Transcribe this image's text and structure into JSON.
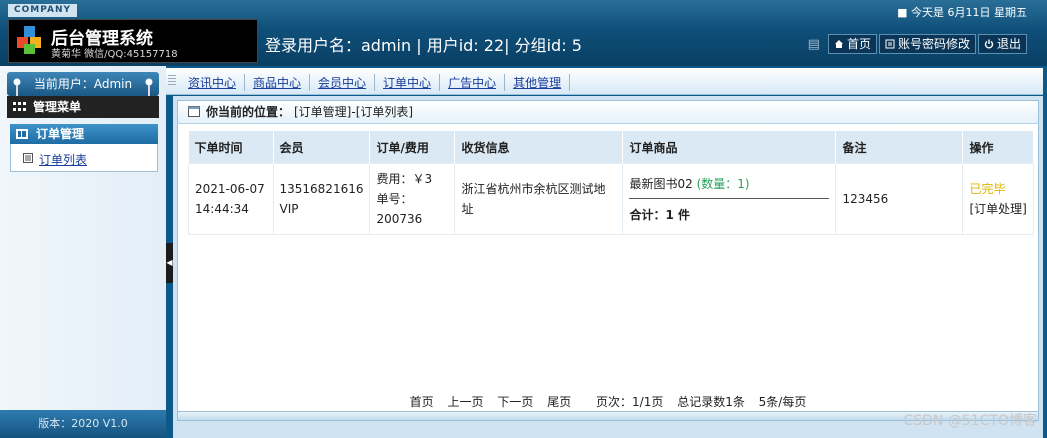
{
  "header": {
    "company_tag": "COMPANY",
    "title": "后台管理系统",
    "subtitle": "黄菊华 微信/QQ:45157718",
    "date_text": "■ 今天是 6月11日 星期五",
    "login_info": "登录用户名：admin | 用户id: 22| 分组id: 5",
    "buttons": [
      {
        "label": "首页",
        "icon": "home-icon"
      },
      {
        "label": "账号密码修改",
        "icon": "account-icon"
      },
      {
        "label": "退出",
        "icon": "power-icon"
      }
    ]
  },
  "nav": {
    "links": [
      "资讯中心",
      "商品中心",
      "会员中心",
      "订单中心",
      "广告中心",
      "其他管理"
    ]
  },
  "sidebar": {
    "current_user": "当前用户：Admin",
    "menu_title": "管理菜单",
    "group_title": "订单管理",
    "items": [
      {
        "label": "订单列表"
      }
    ],
    "version": "版本：2020 V1.0"
  },
  "main": {
    "breadcrumb_label": "你当前的位置：",
    "breadcrumb_path": "[订单管理]-[订单列表]",
    "table": {
      "headers": [
        "下单时间",
        "会员",
        "订单/费用",
        "收货信息",
        "订单商品",
        "备注",
        "操作"
      ],
      "rows": [
        {
          "date": "2021-06-07",
          "time": "14:44:34",
          "member_phone": "13516821616",
          "member_level": "VIP",
          "fee": "费用：￥3",
          "order_no_label": "单号：",
          "order_no": "200736",
          "address": "浙江省杭州市余杭区测试地址",
          "goods_name": "最新图书02",
          "goods_qty": "(数量：1)",
          "goods_total": "合计：1 件",
          "note": "123456",
          "status": "已完毕",
          "action": "[订单处理]"
        }
      ]
    },
    "pager": {
      "first": "首页",
      "prev": "上一页",
      "next": "下一页",
      "last": "尾页",
      "page_info": "页次：1/1页",
      "total": "总记录数1条",
      "per_page": "5条/每页"
    }
  },
  "watermark": "CSDN @51CTO博客",
  "colors": {
    "header_bg": "#0e4f79",
    "accent": "#1e6ca3",
    "status_done": "#e0b400",
    "qty": "#2aa05c"
  }
}
